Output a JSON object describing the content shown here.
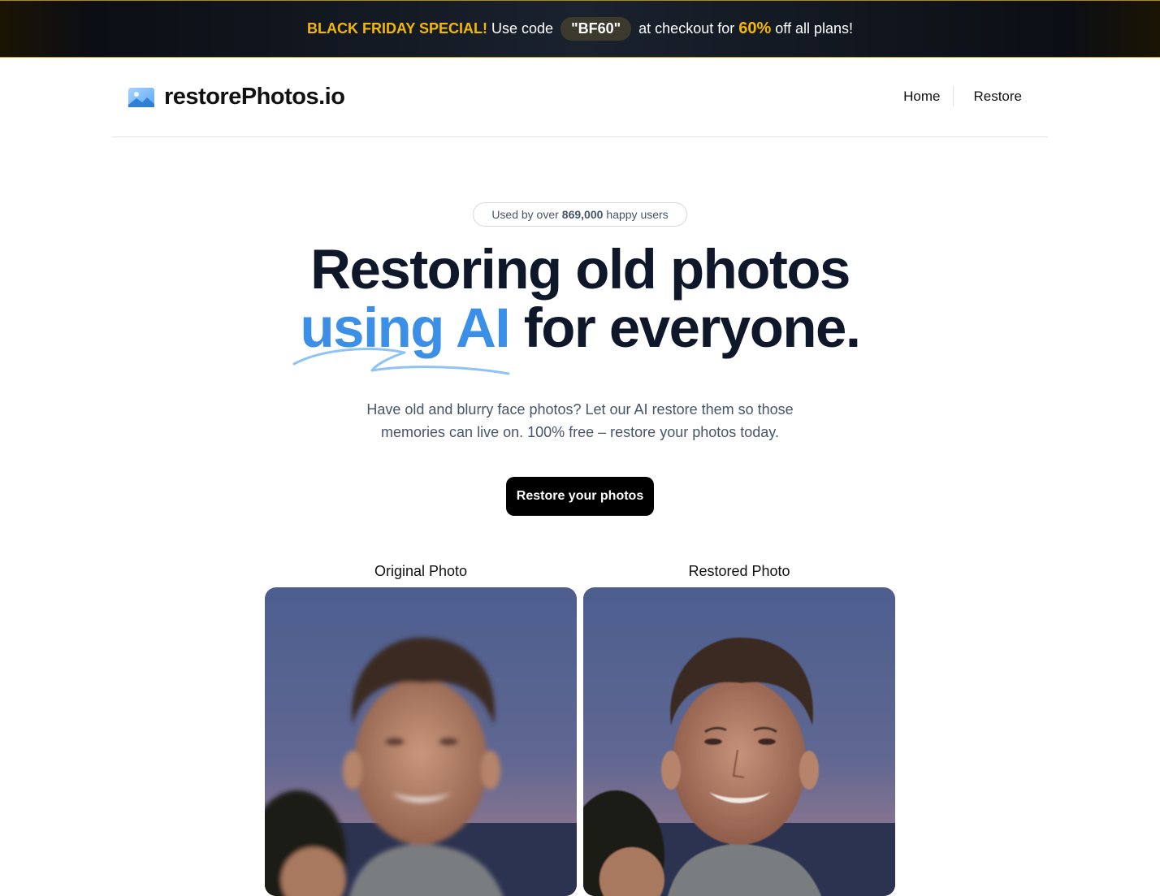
{
  "promo": {
    "headline": "BLACK FRIDAY SPECIAL!",
    "use_code": "Use code",
    "code": "\"BF60\"",
    "at_checkout": "at checkout for",
    "percent": "60%",
    "suffix": "off all plans!"
  },
  "header": {
    "logo_text": "restorePhotos.io",
    "logo_icon": "image-icon",
    "nav": [
      {
        "label": "Home"
      },
      {
        "label": "Restore"
      }
    ]
  },
  "hero": {
    "badge_prefix": "Used by over",
    "badge_count": "869,000",
    "badge_suffix": "happy users",
    "title_line1": "Restoring old photos",
    "title_highlight": "using AI",
    "title_rest": "for everyone.",
    "subtitle": "Have old and blurry face photos? Let our AI restore them so those memories can live on. 100% free – restore your photos today.",
    "cta_label": "Restore your photos"
  },
  "comparison": {
    "original_label": "Original Photo",
    "restored_label": "Restored Photo"
  },
  "colors": {
    "accent_blue": "#3b8fe6",
    "promo_gold": "#f5b800",
    "title_dark": "#0f172a"
  }
}
